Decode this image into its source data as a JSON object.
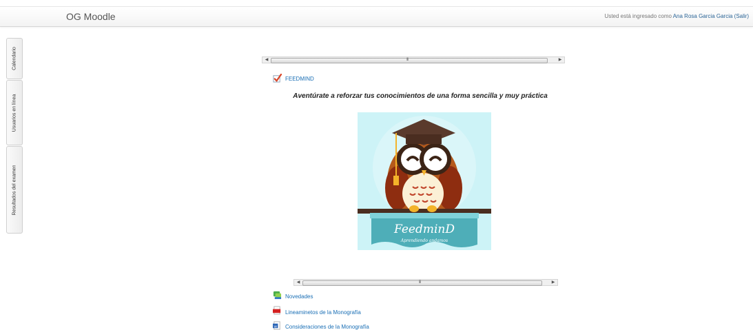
{
  "header": {
    "site_name": "OG Moodle",
    "login_prefix": "Usted está ingresado como",
    "user_name": "Ana Rosa Garcia Garcia",
    "logout_label": "(Salir)"
  },
  "sidebar": {
    "tabs": [
      {
        "label": "Calendario"
      },
      {
        "label": "Usuarios en línea"
      },
      {
        "label": "Resultados del examen"
      }
    ]
  },
  "main": {
    "activity": {
      "label": "FEEDMIND",
      "icon": "checkbox-check-icon"
    },
    "headline": "Aventúrate a reforzar tus conocimientos de una forma sencilla y muy práctica",
    "banner": {
      "title": "FeedminD",
      "subtitle": "Aprendiendo andamos",
      "colors": {
        "background": "#cdf3f7",
        "banner": "#4eaeb8",
        "owl_body": "#b55a1c",
        "cap": "#5a3a2c"
      }
    },
    "scroll_grip": "III",
    "resources": [
      {
        "label": "Novedades",
        "icon": "forum-icon"
      },
      {
        "label": "Lineaminetos de la Monografía",
        "icon": "pdf-file-icon"
      },
      {
        "label": "Consideraciones de la Monografía",
        "icon": "word-file-icon"
      }
    ]
  }
}
